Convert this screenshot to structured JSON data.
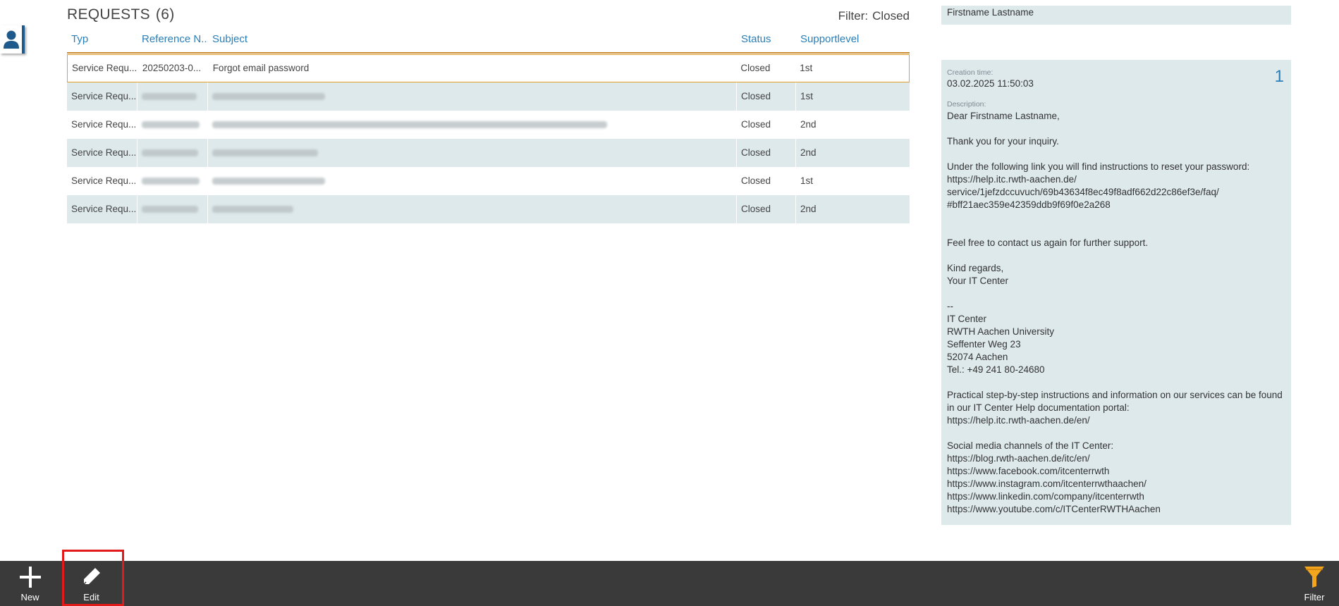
{
  "list": {
    "title": "REQUESTS",
    "count": "(6)",
    "filter_label": "Filter:",
    "filter_value": "Closed",
    "columns": [
      "Typ",
      "Reference N...",
      "Subject",
      "Status",
      "Supportlevel"
    ],
    "rows": [
      {
        "typ": "Service Requ...",
        "ref": "20250203-0...",
        "subject": "Forgot email password",
        "status": "Closed",
        "level": "1st"
      },
      {
        "typ": "Service Requ...",
        "ref": "",
        "subject": "",
        "status": "Closed",
        "level": "1st"
      },
      {
        "typ": "Service Requ...",
        "ref": "",
        "subject": "",
        "status": "Closed",
        "level": "2nd"
      },
      {
        "typ": "Service Requ...",
        "ref": "",
        "subject": "",
        "status": "Closed",
        "level": "2nd"
      },
      {
        "typ": "Service Requ...",
        "ref": "",
        "subject": "",
        "status": "Closed",
        "level": "1st"
      },
      {
        "typ": "Service Requ...",
        "ref": "",
        "subject": "",
        "status": "Closed",
        "level": "2nd"
      }
    ]
  },
  "detail": {
    "top_name": "Firstname Lastname",
    "index": "1",
    "creation_label": "Creation time:",
    "creation_value": "03.02.2025 11:50:03",
    "description_label": "Description:",
    "description_lines": [
      "Dear Firstname Lastname,",
      "",
      "Thank you for your inquiry.",
      "",
      "Under the following link you will find instructions to reset your password:",
      "https://help.itc.rwth-aachen.de/",
      "service/1jefzdccuvuch/69b43634f8ec49f8adf662d22c86ef3e/faq/",
      "#bff21aec359e42359ddb9f69f0e2a268",
      "",
      "",
      "Feel free to contact us again for further support.",
      "",
      "Kind regards,",
      "Your IT Center",
      "",
      "--",
      "IT Center",
      "RWTH Aachen University",
      "Seffenter Weg 23",
      "52074 Aachen",
      "Tel.: +49 241 80-24680",
      "",
      "Practical step-by-step instructions and information on our services can be found",
      "in our IT Center Help documentation portal:",
      "https://help.itc.rwth-aachen.de/en/",
      "",
      "Social media channels of the IT Center:",
      "https://blog.rwth-aachen.de/itc/en/",
      "https://www.facebook.com/itcenterrwth",
      "https://www.instagram.com/itcenterrwthaachen/",
      "https://www.linkedin.com/company/itcenterrwth",
      "https://www.youtube.com/c/ITCenterRWTHAachen"
    ]
  },
  "toolbar": {
    "new_label": "New",
    "edit_label": "Edit",
    "filter_label": "Filter"
  },
  "icons": {
    "user": "user-icon",
    "new": "plus-icon",
    "edit": "pencil-icon",
    "filter": "funnel-icon"
  },
  "colors": {
    "accent_blue": "#2a7fb8",
    "row_alt": "#dee9ec",
    "selection_border": "#e0a030",
    "toolbar_bg": "#3a3a3a",
    "filter_icon": "#f2a51d",
    "highlight": "#e21a1a"
  }
}
